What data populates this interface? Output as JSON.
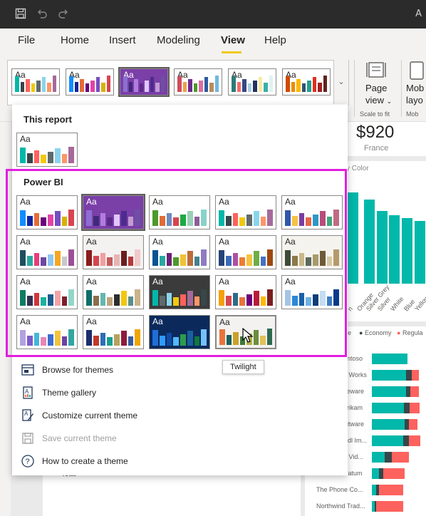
{
  "window": {
    "title_right": "A"
  },
  "menu": {
    "items": [
      "File",
      "Home",
      "Insert",
      "Modeling",
      "View",
      "Help"
    ],
    "active": "View"
  },
  "ribbon": {
    "page_view_label_1": "Page",
    "page_view_label_2": "view",
    "scale_to_fit": "Scale to fit",
    "mobile_label_1": "Mob",
    "mobile_label_2": "layo",
    "mobile_sub": "Mob"
  },
  "report": {
    "kpi_value": "$920",
    "kpi_label": "France",
    "by_color": "y Color",
    "x_labels": [
      "n",
      "Orange",
      "Silver Grey",
      "Silver",
      "White",
      "Blue",
      "Yellow"
    ],
    "legend_economy": "Economy",
    "legend_regular": "Regula",
    "legend_prefix": "e",
    "rows": [
      "ontoso",
      "e Works",
      "seware",
      "brikam",
      "Litware",
      "Adl Im...",
      "e Vid...",
      "Datum",
      "The Phone Co...",
      "Northwind Trad..."
    ],
    "total_label": "Total"
  },
  "dropdown": {
    "this_report_title": "This report",
    "power_bi_title": "Power BI",
    "tile_aa": "Aa",
    "actions": [
      {
        "label": "Browse for themes",
        "icon": "browse-themes-icon",
        "enabled": true
      },
      {
        "label": "Theme gallery",
        "icon": "theme-gallery-icon",
        "enabled": true
      },
      {
        "label": "Customize current theme",
        "icon": "customize-theme-icon",
        "enabled": true
      },
      {
        "label": "Save current theme",
        "icon": "save-theme-icon",
        "enabled": false
      },
      {
        "label": "How to create a theme",
        "icon": "help-icon",
        "enabled": true
      }
    ],
    "tooltip": "Twilight"
  },
  "colors": {
    "accent_highlight": "#e11ee0",
    "underline": "#f2c811"
  },
  "themes": {
    "ribbon_strip": [
      {
        "bg": "#ffffff",
        "dark": false,
        "bars": [
          "#01b8aa",
          "#374649",
          "#fd625e",
          "#f2c80f",
          "#5f6b6d",
          "#8ad4eb",
          "#fe9666",
          "#a66999"
        ]
      },
      {
        "bg": "#ffffff",
        "dark": false,
        "bars": [
          "#118dff",
          "#12239e",
          "#e66c37",
          "#6b007b",
          "#e044a7",
          "#744ec2",
          "#d9b300",
          "#d64550"
        ]
      },
      {
        "bg": "#7b3fa8",
        "dark": true,
        "bars": [
          "#8d6fd1",
          "#3f2a7a",
          "#b07ce0",
          "#5b2a86",
          "#e0c6ff",
          "#4c2c8c",
          "#c39bd3",
          "#6e4fa3"
        ]
      },
      {
        "bg": "#ffffff",
        "dark": false,
        "bars": [
          "#ce4b5b",
          "#f29e4c",
          "#6e2c90",
          "#4c9a2a",
          "#e06c9f",
          "#2c5aa0",
          "#b98c5b",
          "#6fb7e0"
        ]
      },
      {
        "bg": "#ffffff",
        "dark": false,
        "bars": [
          "#2b7a78",
          "#f76c6c",
          "#374785",
          "#a8d0e6",
          "#24305e",
          "#f8e9a1",
          "#3aafa9",
          "#def2f1"
        ]
      },
      {
        "bg": "#ffffff",
        "dark": false,
        "bars": [
          "#d04a02",
          "#eb8c00",
          "#ffb600",
          "#295477",
          "#299d8f",
          "#e0301e",
          "#a32020",
          "#602320"
        ]
      }
    ],
    "this_report": [
      {
        "bg": "#ffffff",
        "dark": false,
        "bars": [
          "#01b8aa",
          "#374649",
          "#fd625e",
          "#f2c80f",
          "#5f6b6d",
          "#8ad4eb",
          "#fe9666",
          "#a66999"
        ]
      }
    ],
    "power_bi": [
      {
        "bg": "#ffffff",
        "dark": false,
        "bars": [
          "#118dff",
          "#12239e",
          "#e66c37",
          "#6b007b",
          "#e044a7",
          "#744ec2",
          "#d9b300",
          "#d64550"
        ]
      },
      {
        "bg": "#7b3fa8",
        "dark": true,
        "bars": [
          "#8d6fd1",
          "#3f2a7a",
          "#b07ce0",
          "#5b2a86",
          "#e0c6ff",
          "#4c2c8c",
          "#c39bd3",
          "#6e4fa3"
        ]
      },
      {
        "bg": "#ffffff",
        "dark": false,
        "bars": [
          "#4c9a2a",
          "#e06c37",
          "#6e8bbf",
          "#d64550",
          "#1aab40",
          "#98d0b6",
          "#8c5d99",
          "#88d2ca"
        ]
      },
      {
        "bg": "#ffffff",
        "dark": false,
        "bars": [
          "#01b8aa",
          "#374649",
          "#fd625e",
          "#f2c80f",
          "#5f6b6d",
          "#8ad4eb",
          "#fe9666",
          "#a66999"
        ]
      },
      {
        "bg": "#ffffff",
        "dark": false,
        "bars": [
          "#3257a8",
          "#f6c342",
          "#7a3ea1",
          "#e6674a",
          "#2d98c7",
          "#b94c7b",
          "#40a77b",
          "#c06c84"
        ]
      },
      {
        "bg": "#ffffff",
        "dark": false,
        "bars": [
          "#1f4e5f",
          "#2aa8a0",
          "#e93d7b",
          "#6b48a3",
          "#8fc7f1",
          "#f6a623",
          "#c9c9c9",
          "#9c4f96"
        ]
      },
      {
        "bg": "#f3f2f1",
        "dark": false,
        "bars": [
          "#8a1c1c",
          "#d64550",
          "#f29e9e",
          "#c45a5a",
          "#e8b4b4",
          "#6a1e1e",
          "#b33a3a",
          "#f0c9c9"
        ]
      },
      {
        "bg": "#ffffff",
        "dark": false,
        "bars": [
          "#0b5394",
          "#2aa8a0",
          "#6d2077",
          "#4c9a2a",
          "#f1c232",
          "#bf6c3a",
          "#45818e",
          "#8e7cc3"
        ]
      },
      {
        "bg": "#ffffff",
        "dark": false,
        "bars": [
          "#264478",
          "#3d6ab8",
          "#b04fa5",
          "#ed7d31",
          "#f5c342",
          "#70ad47",
          "#4472c4",
          "#9e480e"
        ]
      },
      {
        "bg": "#f5f3ee",
        "dark": false,
        "bars": [
          "#3c4a3a",
          "#8a7a4a",
          "#c9b78a",
          "#5a6a5a",
          "#a89b6b",
          "#6e5a3a",
          "#d6c9a6",
          "#b59a6a"
        ]
      },
      {
        "bg": "#ffffff",
        "dark": false,
        "bars": [
          "#0e7c61",
          "#31304f",
          "#d0353d",
          "#1ab39f",
          "#1f5b8e",
          "#f5a3a6",
          "#7d1f2b",
          "#93d6c8"
        ]
      },
      {
        "bg": "#ffffff",
        "dark": false,
        "bars": [
          "#0f6e6a",
          "#8a6f4e",
          "#63b7b0",
          "#bea47c",
          "#2d2d2d",
          "#f2c80f",
          "#5a8f8c",
          "#c9b38a"
        ]
      },
      {
        "bg": "#3b3b3b",
        "dark": true,
        "bars": [
          "#01b8aa",
          "#5f6b6d",
          "#8ad4eb",
          "#f2c80f",
          "#fd625e",
          "#a66999",
          "#fe9666",
          "#374649"
        ]
      },
      {
        "bg": "#ffffff",
        "dark": false,
        "bars": [
          "#f4a00a",
          "#d64550",
          "#2b6c8a",
          "#e8743b",
          "#6b007b",
          "#b81d38",
          "#ffb900",
          "#7a1e1e"
        ]
      },
      {
        "bg": "#ffffff",
        "dark": false,
        "bars": [
          "#a3c4e8",
          "#2b88d8",
          "#1a5fa8",
          "#6fb2e4",
          "#0e3d7a",
          "#c5dcf2",
          "#3c7bc4",
          "#083a8a"
        ]
      },
      {
        "bg": "#ffffff",
        "dark": false,
        "bars": [
          "#b3a0e0",
          "#7a5cc9",
          "#45b5d8",
          "#e886b6",
          "#3c6fce",
          "#f3c33c",
          "#6c41a8",
          "#33a5a2"
        ]
      },
      {
        "bg": "#ffffff",
        "dark": false,
        "bars": [
          "#1a2d6d",
          "#c0392b",
          "#2c6eb5",
          "#1a9e8f",
          "#b5a35c",
          "#8b1c3d",
          "#355c9e",
          "#f0a500"
        ]
      },
      {
        "bg": "#0b2a5b",
        "dark": true,
        "bars": [
          "#1e6fd9",
          "#2f9bff",
          "#0d4aa6",
          "#4fb8ff",
          "#2a9d4a",
          "#1a5f9e",
          "#0e7a3e",
          "#74c0ff"
        ]
      },
      {
        "bg": "#f3f2f1",
        "dark": false,
        "bars": [
          "#e8743b",
          "#1a5f5e",
          "#c9a227",
          "#3c7a3c",
          "#b6b14a",
          "#6b8e3c",
          "#e0c25a",
          "#2d6a4f"
        ]
      }
    ]
  }
}
